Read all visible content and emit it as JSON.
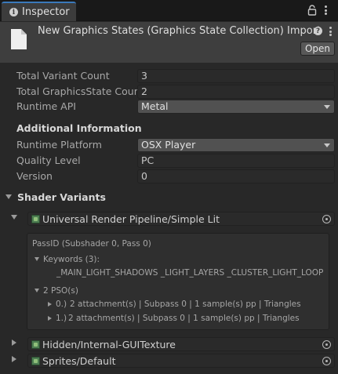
{
  "tab": {
    "label": "Inspector"
  },
  "header": {
    "title": "New Graphics States (Graphics State Collection) Import",
    "open_label": "Open"
  },
  "fields": {
    "total_variant_count": {
      "label": "Total Variant Count",
      "value": "3"
    },
    "total_graphicsstate_count": {
      "label": "Total GraphicsState Count",
      "value": "2"
    },
    "runtime_api": {
      "label": "Runtime API",
      "value": "Metal"
    }
  },
  "additional": {
    "heading": "Additional Information",
    "runtime_platform": {
      "label": "Runtime Platform",
      "value": "OSX Player"
    },
    "quality_level": {
      "label": "Quality Level",
      "value": "PC"
    },
    "version": {
      "label": "Version",
      "value": "0"
    }
  },
  "shader_variants": {
    "heading": "Shader Variants",
    "shaders": [
      {
        "name": "Universal Render Pipeline/Simple Lit",
        "expanded": true
      },
      {
        "name": "Hidden/Internal-GUITexture",
        "expanded": false
      },
      {
        "name": "Sprites/Default",
        "expanded": false
      }
    ],
    "details": {
      "pass_id": "PassID (Subshader 0, Pass 0)",
      "keywords_label": "Keywords (3):",
      "keywords": "_MAIN_LIGHT_SHADOWS  _LIGHT_LAYERS  _CLUSTER_LIGHT_LOOP",
      "pso_label": "2 PSO(s)",
      "psos": [
        {
          "index": "0.)",
          "text": "2 attachment(s) | Subpass 0 | 1 sample(s) pp | Triangles"
        },
        {
          "index": "1.)",
          "text": "2 attachment(s) | Subpass 0 | 1 sample(s) pp | Triangles"
        }
      ]
    }
  }
}
